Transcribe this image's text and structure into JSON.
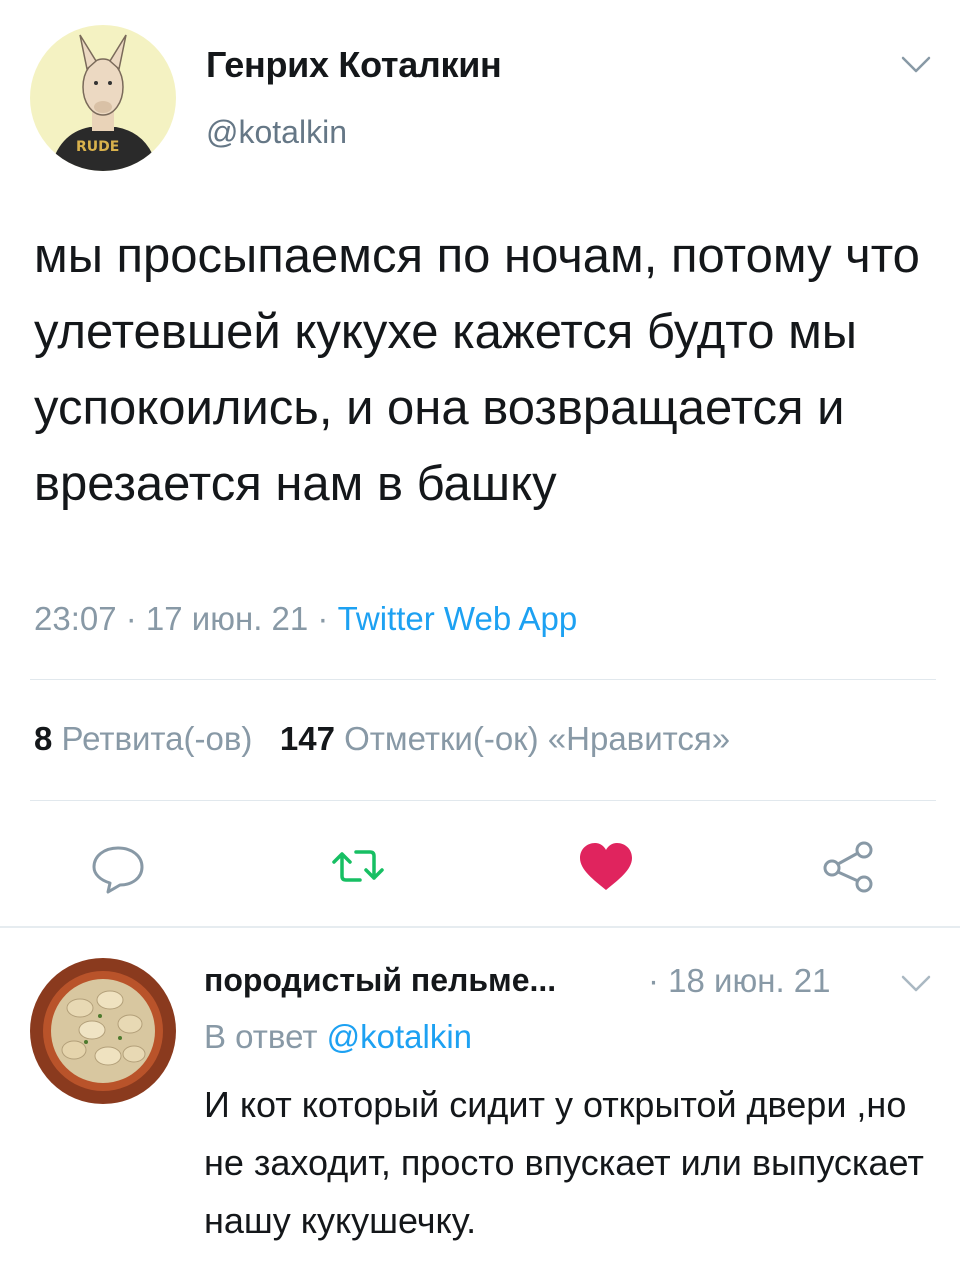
{
  "tweet": {
    "author_name": "Генрих Коталкин",
    "author_handle": "@kotalkin",
    "avatar_shirt_text": "RUDE",
    "text": "мы просыпаемся по ночам, потому что улетевшей кукухе кажется будто мы успокоились, и она возвращается и врезается нам в башку",
    "time": "23:07",
    "date": "17 июн. 21",
    "meta_separator": " · ",
    "source": "Twitter Web App",
    "retweets_count": "8",
    "retweets_label": "Ретвита(-ов)",
    "likes_count": "147",
    "likes_label": "Отметки(-ок) «Нравится»",
    "liked": true
  },
  "actions": [
    {
      "name": "reply",
      "icon": "comment-icon"
    },
    {
      "name": "retweet",
      "icon": "retweet-icon"
    },
    {
      "name": "like",
      "icon": "heart-icon"
    },
    {
      "name": "share",
      "icon": "share-icon"
    }
  ],
  "reply": {
    "author_name": "породистый пельме...",
    "date": "· 18 июн. 21",
    "reply_to_prefix": "В ответ",
    "reply_to_handle": "@kotalkin",
    "text": "И кот который сидит у открытой двери ,но не заходит, просто впускает или выпускает нашу кукушечку."
  },
  "colors": {
    "accent": "#1da1f2",
    "like": "#e0245e",
    "muted": "#8899a6",
    "text": "#14171a"
  }
}
